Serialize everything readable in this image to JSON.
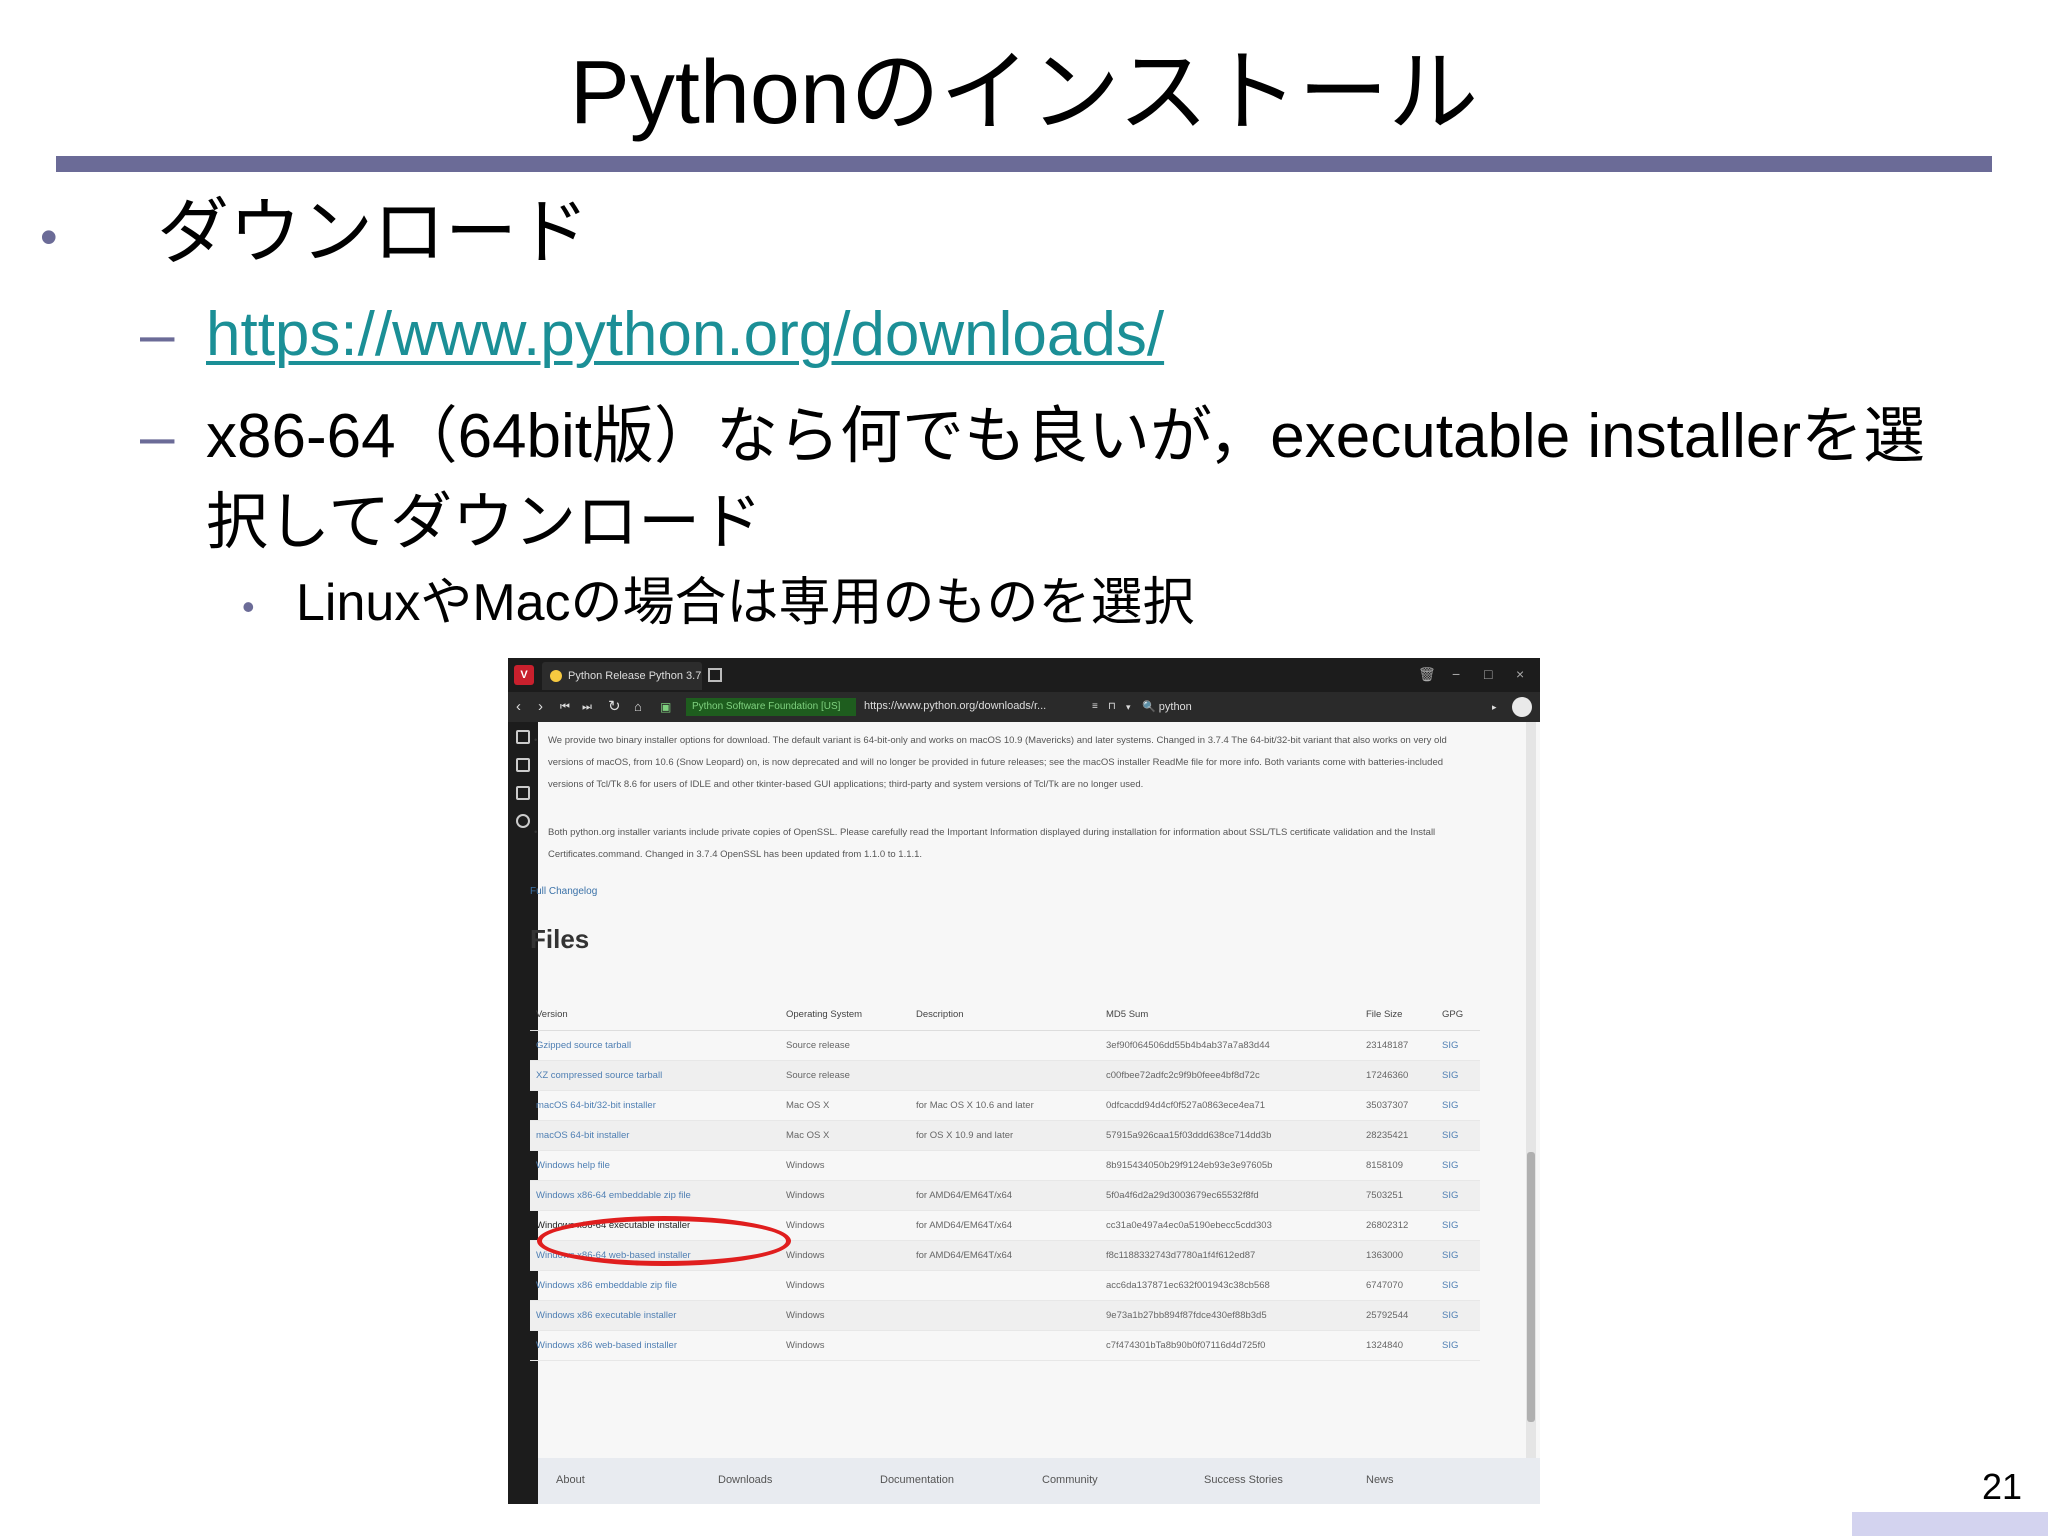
{
  "slide": {
    "title": "Pythonのインストール",
    "bullet1": "ダウンロード",
    "sub1_link": "https://www.python.org/downloads/",
    "sub2_line1": "x86-64（64bit版）なら何でも良いが，executable installerを選",
    "sub2_line2": "択してダウンロード",
    "sub3": "LinuxやMacの場合は専用のものを選択",
    "page_number": "21",
    "bullet_glyph": "•",
    "dash_glyph": "–"
  },
  "browser": {
    "tab_title": "Python Release Python 3.7",
    "secure_label": "Python Software Foundation [US]",
    "url": "https://www.python.org/downloads/r...",
    "search_text": "python",
    "para1": "We provide two binary installer options for download. The default variant is 64-bit-only and works on macOS 10.9 (Mavericks) and later systems. Changed in 3.7.4 The 64-bit/32-bit variant that also works on very old versions of macOS, from 10.6 (Snow Leopard) on, is now deprecated and will no longer be provided in future releases; see the macOS installer ReadMe file for more info. Both variants come with batteries-included versions of Tcl/Tk 8.6 for users of IDLE and other tkinter-based GUI applications; third-party and system versions of Tcl/Tk are no longer used.",
    "para2": "Both python.org installer variants include private copies of OpenSSL. Please carefully read the Important Information displayed during installation for information about SSL/TLS certificate validation and the Install Certificates.command. Changed in 3.7.4 OpenSSL has been updated from 1.1.0 to 1.1.1.",
    "changelog": "Full Changelog",
    "files_heading": "Files",
    "table": {
      "headers": [
        "Version",
        "Operating System",
        "Description",
        "MD5 Sum",
        "File Size",
        "GPG"
      ],
      "rows": [
        [
          "Gzipped source tarball",
          "Source release",
          "",
          "3ef90f064506dd55b4b4ab37a7a83d44",
          "23148187",
          "SIG"
        ],
        [
          "XZ compressed source tarball",
          "Source release",
          "",
          "c00fbee72adfc2c9f9b0feee4bf8d72c",
          "17246360",
          "SIG"
        ],
        [
          "macOS 64-bit/32-bit installer",
          "Mac OS X",
          "for Mac OS X 10.6 and later",
          "0dfcacdd94d4cf0f527a0863ece4ea71",
          "35037307",
          "SIG"
        ],
        [
          "macOS 64-bit installer",
          "Mac OS X",
          "for OS X 10.9 and later",
          "57915a926caa15f03ddd638ce714dd3b",
          "28235421",
          "SIG"
        ],
        [
          "Windows help file",
          "Windows",
          "",
          "8b915434050b29f9124eb93e3e97605b",
          "8158109",
          "SIG"
        ],
        [
          "Windows x86-64 embeddable zip file",
          "Windows",
          "for AMD64/EM64T/x64",
          "5f0a4f6d2a29d3003679ec65532f8fd",
          "7503251",
          "SIG"
        ],
        [
          "Windows x86-64 executable installer",
          "Windows",
          "for AMD64/EM64T/x64",
          "cc31a0e497a4ec0a5190ebecc5cdd303",
          "26802312",
          "SIG"
        ],
        [
          "Windows x86-64 web-based installer",
          "Windows",
          "for AMD64/EM64T/x64",
          "f8c1188332743d7780a1f4f612ed87",
          "1363000",
          "SIG"
        ],
        [
          "Windows x86 embeddable zip file",
          "Windows",
          "",
          "acc6da137871ec632f001943c38cb568",
          "6747070",
          "SIG"
        ],
        [
          "Windows x86 executable installer",
          "Windows",
          "",
          "9e73a1b27bb894f87fdce430ef88b3d5",
          "25792544",
          "SIG"
        ],
        [
          "Windows x86 web-based installer",
          "Windows",
          "",
          "c7f474301bTa8b90b0f07116d4d725f0",
          "1324840",
          "SIG"
        ]
      ]
    },
    "footer": [
      "About",
      "Downloads",
      "Documentation",
      "Community",
      "Success Stories",
      "News"
    ]
  },
  "colors": {
    "accent": "#6b6b97",
    "link": "#1b8f96",
    "highlight": "#e01e1e"
  }
}
